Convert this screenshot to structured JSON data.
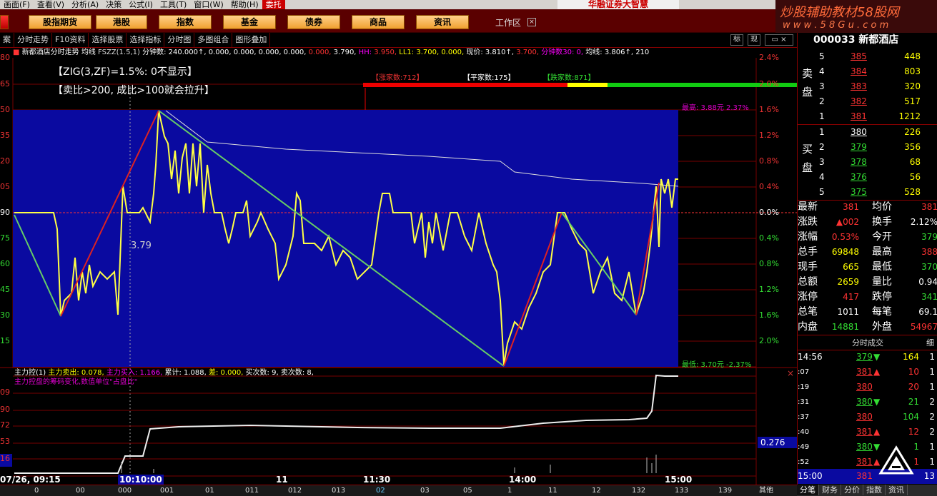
{
  "menu": {
    "items": [
      "画面(F)",
      "查看(V)",
      "分析(A)",
      "决策",
      "公式(I)",
      "工具(T)",
      "窗口(W)",
      "帮助(H)"
    ],
    "trade": "委托",
    "brand": "华融证券大智慧"
  },
  "toolbar": {
    "buttons": [
      "股指期货",
      "港股",
      "指数",
      "基金",
      "债券",
      "商品",
      "资讯"
    ],
    "workzone": "工作区",
    "workzone_close": "×"
  },
  "watermark": {
    "line1": "炒股辅助教材58股网",
    "line2": "w w w . 5 8 G u . c o m"
  },
  "subtoolbar": {
    "items": [
      "案",
      "分时走势",
      "F10资料",
      "选择股票",
      "选择指标",
      "分时图",
      "多图组合",
      "图形叠加"
    ],
    "btn_biao": "标",
    "btn_xian": "现"
  },
  "indicator_line": {
    "name": "新都酒店分时走势",
    "avg": "均线",
    "fszz": "FSZZ(1.5,1)",
    "vol": "分钟数: 240.000↑, 0.000, 0.000, 0.000, 0.000,",
    "price_a": "0.000,",
    "price_b": "3.790,",
    "hh": "HH:",
    "hh_val": "3.950,",
    "ll": "LL1: 3.700, 0.000,",
    "price_now": "现价: 3.810↑,",
    "price_now2": "3.700,",
    "minutes": "分钟数30: 0,",
    "avg_val": "均线: 3.806↑,",
    "tail": "210"
  },
  "notes": {
    "zig": "【ZIG(3,ZF)=1.5%:   0不显示】",
    "rule": "【卖比>200,   成比>100就会拉升】"
  },
  "breadth": {
    "up": "【涨家数:712】",
    "flat": "【平家数:175】",
    "down": "【跌家数:871】"
  },
  "chart_labels": {
    "high": "最高: 3.88元  2.37%",
    "low": "最低: 3.70元  -2.37%",
    "point": "3.79"
  },
  "left_axis": [
    "80",
    "65",
    "50",
    "35",
    "20",
    "05",
    "90",
    "75",
    "60",
    "45",
    "30",
    "15"
  ],
  "right_axis": [
    "2.4%",
    "2.0%",
    "1.6%",
    "1.2%",
    "0.8%",
    "0.4%",
    "0.0%",
    "0.4%",
    "0.8%",
    "1.2%",
    "1.6%",
    "2.0%"
  ],
  "sub_indicator": {
    "title": "主力控(1)",
    "out": "主力卖出: 0.078,",
    "in": "主力买入: 1.166,",
    "cum": "累计: 1.088,",
    "diff": "差: 0.000,",
    "buy_cnt": "买次数: 9,",
    "sell_cnt": "卖次数: 8,",
    "desc": "主力控盘的筹码变化,数值单位\"占盘比\"",
    "right_value": "0.276",
    "left_axis": [
      "09",
      "90",
      "72",
      "53",
      "16"
    ],
    "close": "×"
  },
  "time_axis": {
    "date": "07/26, 09:15",
    "labels": [
      "10:10:00",
      "11",
      "11:30",
      "14:00",
      "15:00"
    ],
    "ticks": [
      "0",
      "00",
      "000",
      "001",
      "01",
      "011",
      "012",
      "013",
      "02",
      "03",
      "05",
      "1",
      "11",
      "12",
      "132",
      "133",
      "139",
      "其他"
    ]
  },
  "quote": {
    "code": "000033 新都酒店",
    "sell_label": "卖盘",
    "buy_label": "买盘",
    "sell": [
      {
        "lvl": "5",
        "price": "385",
        "vol": "448"
      },
      {
        "lvl": "4",
        "price": "384",
        "vol": "803"
      },
      {
        "lvl": "3",
        "price": "383",
        "vol": "320"
      },
      {
        "lvl": "2",
        "price": "382",
        "vol": "517"
      },
      {
        "lvl": "1",
        "price": "381",
        "vol": "1212"
      }
    ],
    "buy": [
      {
        "lvl": "1",
        "price": "380",
        "vol": "226"
      },
      {
        "lvl": "2",
        "price": "379",
        "vol": "356"
      },
      {
        "lvl": "3",
        "price": "378",
        "vol": "68"
      },
      {
        "lvl": "4",
        "price": "376",
        "vol": "56"
      },
      {
        "lvl": "5",
        "price": "375",
        "vol": "528"
      }
    ],
    "stats": [
      {
        "k1": "最新",
        "v1": "381",
        "k2": "均价",
        "v2": "381"
      },
      {
        "k1": "涨跌",
        "v1": "▲002",
        "k2": "换手",
        "v2": "2.12%"
      },
      {
        "k1": "涨幅",
        "v1": "0.53%",
        "k2": "今开",
        "v2": "379"
      },
      {
        "k1": "总手",
        "v1": "69848",
        "k2": "最高",
        "v2": "388"
      },
      {
        "k1": "现手",
        "v1": "665",
        "k2": "最低",
        "v2": "370"
      },
      {
        "k1": "总额",
        "v1": "2659",
        "k2": "量比",
        "v2": "0.94"
      },
      {
        "k1": "涨停",
        "v1": "417",
        "k2": "跌停",
        "v2": "341"
      },
      {
        "k1": "总笔",
        "v1": "1011",
        "k2": "每笔",
        "v2": "69.1"
      },
      {
        "k1": "内盘",
        "v1": "14881",
        "k2": "外盘",
        "v2": "54967"
      }
    ],
    "ticks_title": "分时成交",
    "ticks_col": "细",
    "ticks": [
      {
        "t": "14:56",
        "p": "379",
        "d": "down",
        "v": "164",
        "n": "1"
      },
      {
        "t": ":07",
        "p": "381",
        "d": "up",
        "v": "10",
        "n": "1"
      },
      {
        "t": ":19",
        "p": "380",
        "d": "",
        "v": "20",
        "n": "1"
      },
      {
        "t": ":31",
        "p": "380",
        "d": "down",
        "v": "21",
        "n": "2"
      },
      {
        "t": ":37",
        "p": "380",
        "d": "",
        "v": "104",
        "n": "2"
      },
      {
        "t": ":40",
        "p": "381",
        "d": "up",
        "v": "12",
        "n": "2"
      },
      {
        "t": ":49",
        "p": "380",
        "d": "down",
        "v": "1",
        "n": "1"
      },
      {
        "t": ":52",
        "p": "381",
        "d": "up",
        "v": "1",
        "n": "1"
      }
    ],
    "last_time": "15:00",
    "last_price": "381",
    "last_n": "13",
    "tabs": [
      "分笔",
      "财务",
      "分价",
      "指数",
      "资讯"
    ]
  }
}
